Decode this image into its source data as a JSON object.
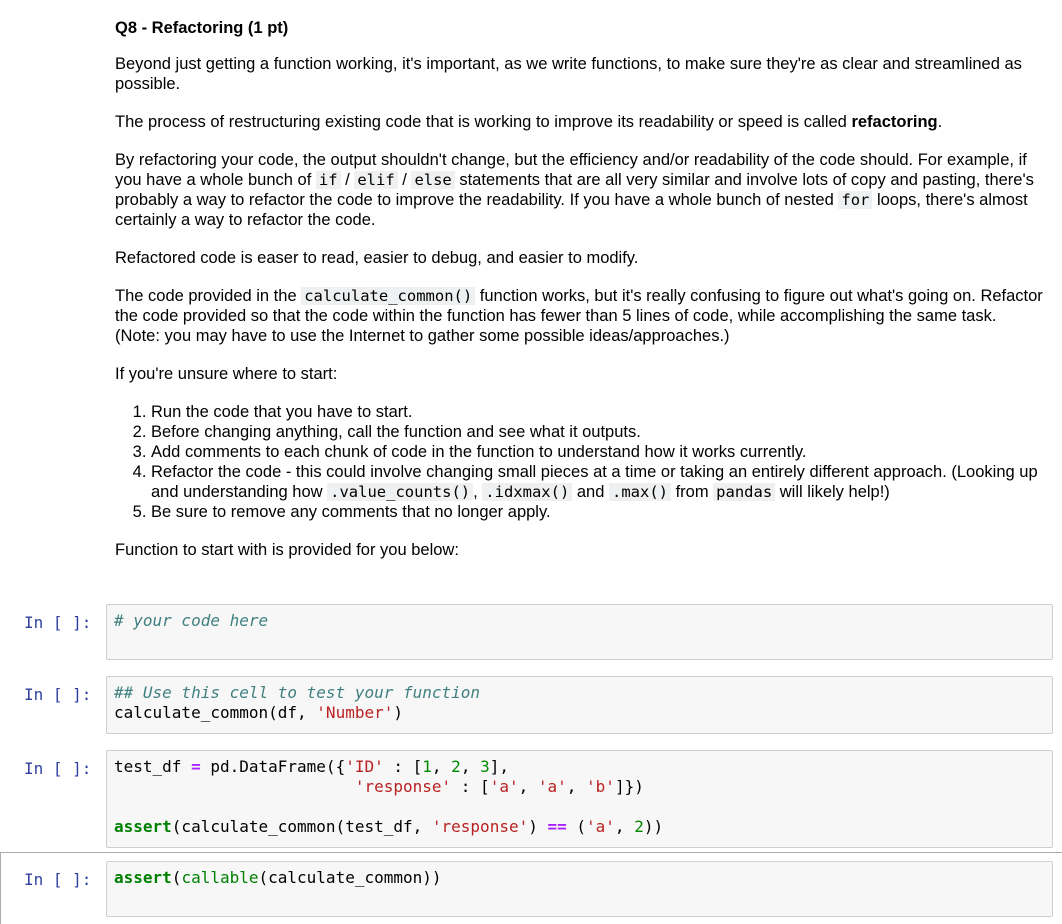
{
  "markdown": {
    "heading": "Q8 - Refactoring (1 pt)",
    "p1": "Beyond just getting a function working, it's important, as we write functions, to make sure they're as clear and streamlined as possible.",
    "p2_pre": "The process of restructuring existing code that is working to improve its readability or speed is called ",
    "p2_bold": "refactoring",
    "p2_post": ".",
    "p3_a": "By refactoring your code, the output shouldn't change, but the efficiency and/or readability of the code should. For example, if you have a whole bunch of ",
    "p3_code1": "if",
    "p3_slash1": " / ",
    "p3_code2": "elif",
    "p3_slash2": " / ",
    "p3_code3": "else",
    "p3_b": " statements that are all very similar and involve lots of copy and pasting, there's probably a way to refactor the code to improve the readability. If you have a whole bunch of nested ",
    "p3_code4": "for",
    "p3_c": " loops, there's almost certainly a way to refactor the code.",
    "p4": "Refactored code is easer to read, easier to debug, and easier to modify.",
    "p5_a": "The code provided in the ",
    "p5_code": "calculate_common()",
    "p5_b": " function works, but it's really confusing to figure out what's going on. Refactor the code provided so that the code within the function has fewer than 5 lines of code, while accomplishing the same task. (Note: you may have to use the Internet to gather some possible ideas/approaches.)",
    "p6": "If you're unsure where to start:",
    "steps": {
      "s1": "Run the code that you have to start.",
      "s2": "Before changing anything, call the function and see what it outputs.",
      "s3": "Add comments to each chunk of code in the function to understand how it works currently.",
      "s4_a": "Refactor the code - this could involve changing small pieces at a time or taking an entirely different approach. (Looking up and understanding how ",
      "s4_code1": ".value_counts()",
      "s4_sep1": ", ",
      "s4_code2": ".idxmax()",
      "s4_sep2": " and ",
      "s4_code3": ".max()",
      "s4_sep3": " from ",
      "s4_code4": "pandas",
      "s4_b": " will likely help!)",
      "s5": "Be sure to remove any comments that no longer apply."
    },
    "p7": "Function to start with is provided for you below:"
  },
  "cells": {
    "prompt": "In [ ]:",
    "c1_comment": "# your code here",
    "c2_comment": "## Use this cell to test your function",
    "c2_call": "calculate_common(df, ",
    "c2_str": "'Number'",
    "c2_close": ")",
    "c3_l1_a": "test_df ",
    "c3_l1_op": "=",
    "c3_l1_b": " pd.DataFrame({",
    "c3_l1_s1": "'ID'",
    "c3_l1_c": " : [",
    "c3_l1_n1": "1",
    "c3_l1_d": ", ",
    "c3_l1_n2": "2",
    "c3_l1_e": ", ",
    "c3_l1_n3": "3",
    "c3_l1_f": "],",
    "c3_l2_pad": "                         ",
    "c3_l2_s1": "'response'",
    "c3_l2_a": " : [",
    "c3_l2_s2": "'a'",
    "c3_l2_b": ", ",
    "c3_l2_s3": "'a'",
    "c3_l2_c": ", ",
    "c3_l2_s4": "'b'",
    "c3_l2_d": "]})",
    "c3_l4_kw": "assert",
    "c3_l4_a": "(calculate_common(test_df, ",
    "c3_l4_s1": "'response'",
    "c3_l4_b": ") ",
    "c3_l4_op": "==",
    "c3_l4_c": " (",
    "c3_l4_s2": "'a'",
    "c3_l4_d": ", ",
    "c3_l4_n": "2",
    "c3_l4_e": "))",
    "c4_kw": "assert",
    "c4_a": "(",
    "c4_builtin": "callable",
    "c4_b": "(calculate_common))"
  }
}
